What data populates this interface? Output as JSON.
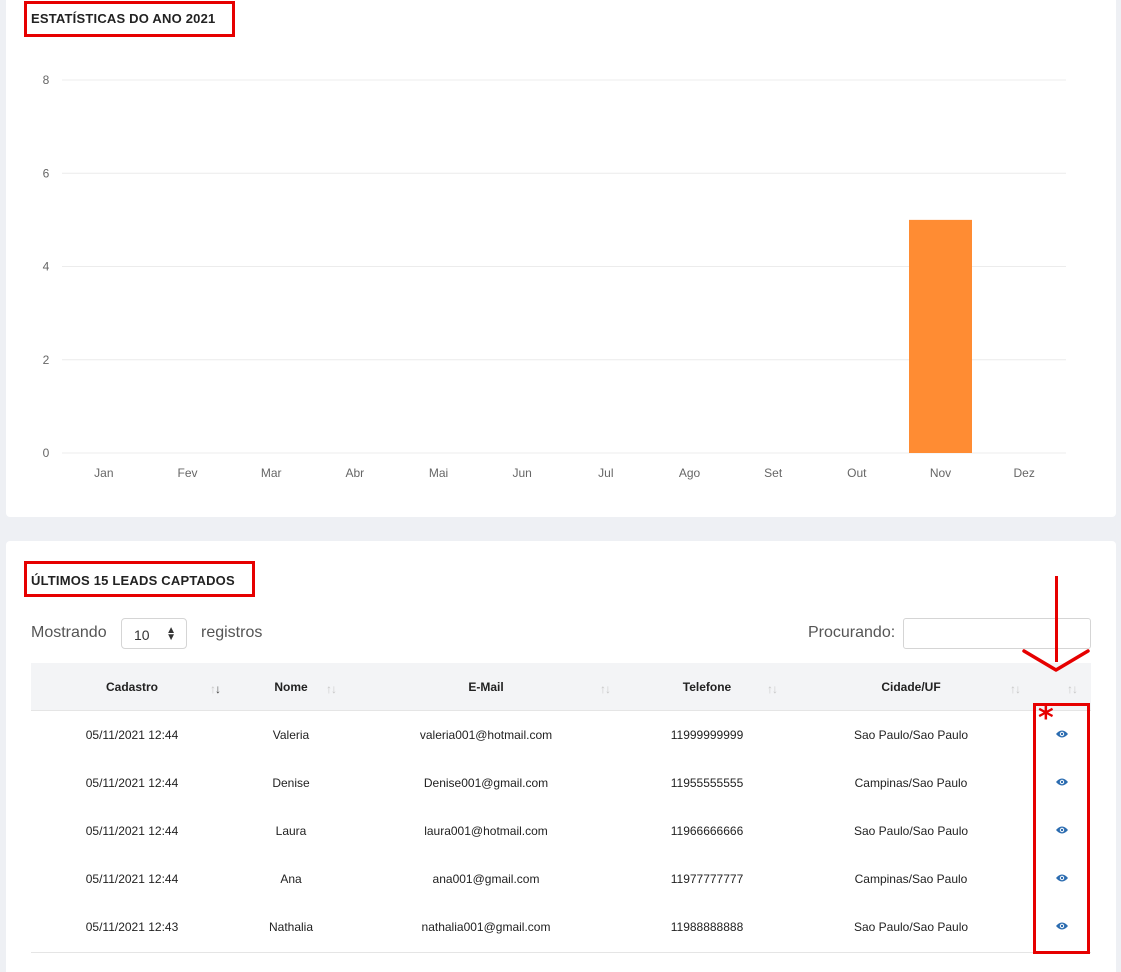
{
  "stats": {
    "title": "ESTATÍSTICAS DO ANO 2021"
  },
  "chart_data": {
    "type": "bar",
    "title": "ESTATÍSTICAS DO ANO 2021",
    "categories": [
      "Jan",
      "Fev",
      "Mar",
      "Abr",
      "Mai",
      "Jun",
      "Jul",
      "Ago",
      "Set",
      "Out",
      "Nov",
      "Dez"
    ],
    "values": [
      0,
      0,
      0,
      0,
      0,
      0,
      0,
      0,
      0,
      0,
      5,
      0
    ],
    "yticks": [
      "8",
      "6",
      "4",
      "2",
      "0"
    ],
    "ylim": [
      0,
      8
    ],
    "grid": true,
    "bar_color": "#ff8c33"
  },
  "leads": {
    "title": "ÚLTIMOS 15 LEADS CAPTADOS",
    "show_label": "Mostrando",
    "length_value": "10",
    "records_label": "registros",
    "search_label": "Procurando:",
    "search_value": "",
    "columns": [
      "Cadastro",
      "Nome",
      "E-Mail",
      "Telefone",
      "Cidade/UF"
    ],
    "rows": [
      {
        "cadastro": "05/11/2021 12:44",
        "nome": "Valeria",
        "email": "valeria001@hotmail.com",
        "telefone": "11999999999",
        "cidade": "Sao Paulo/Sao Paulo",
        "action_icon": "eye-icon"
      },
      {
        "cadastro": "05/11/2021 12:44",
        "nome": "Denise",
        "email": "Denise001@gmail.com",
        "telefone": "11955555555",
        "cidade": "Campinas/Sao Paulo",
        "action_icon": "eye-icon"
      },
      {
        "cadastro": "05/11/2021 12:44",
        "nome": "Laura",
        "email": "laura001@hotmail.com",
        "telefone": "11966666666",
        "cidade": "Sao Paulo/Sao Paulo",
        "action_icon": "eye-icon"
      },
      {
        "cadastro": "05/11/2021 12:44",
        "nome": "Ana",
        "email": "ana001@gmail.com",
        "telefone": "11977777777",
        "cidade": "Campinas/Sao Paulo",
        "action_icon": "eye-icon"
      },
      {
        "cadastro": "05/11/2021 12:43",
        "nome": "Nathalia",
        "email": "nathalia001@gmail.com",
        "telefone": "11988888888",
        "cidade": "Sao Paulo/Sao Paulo",
        "action_icon": "eye-icon"
      }
    ]
  },
  "annotations": {
    "asterisk": "*",
    "highlight_color": "#e60000"
  }
}
